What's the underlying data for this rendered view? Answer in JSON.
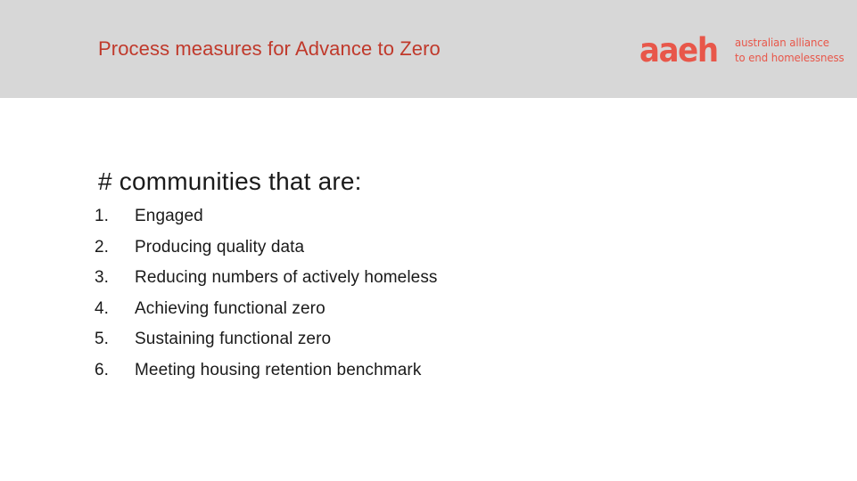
{
  "header": {
    "title": "Process measures for Advance to Zero",
    "background_color": "#d7d7d7",
    "title_color": "#c0392b",
    "logo": {
      "wordmark": "aaeh",
      "tagline_line1": "australian alliance",
      "tagline_line2": "to end homelessness",
      "color": "#e8574a"
    }
  },
  "body": {
    "heading": "# communities that are:",
    "heading_color": "#1a1a1a",
    "items": [
      {
        "number": "1.",
        "label": "Engaged"
      },
      {
        "number": "2.",
        "label": "Producing quality data"
      },
      {
        "number": "3.",
        "label": "Reducing numbers of actively homeless"
      },
      {
        "number": "4.",
        "label": "Achieving functional zero"
      },
      {
        "number": "5.",
        "label": "Sustaining functional zero"
      },
      {
        "number": "6.",
        "label": "Meeting housing retention benchmark"
      }
    ]
  }
}
